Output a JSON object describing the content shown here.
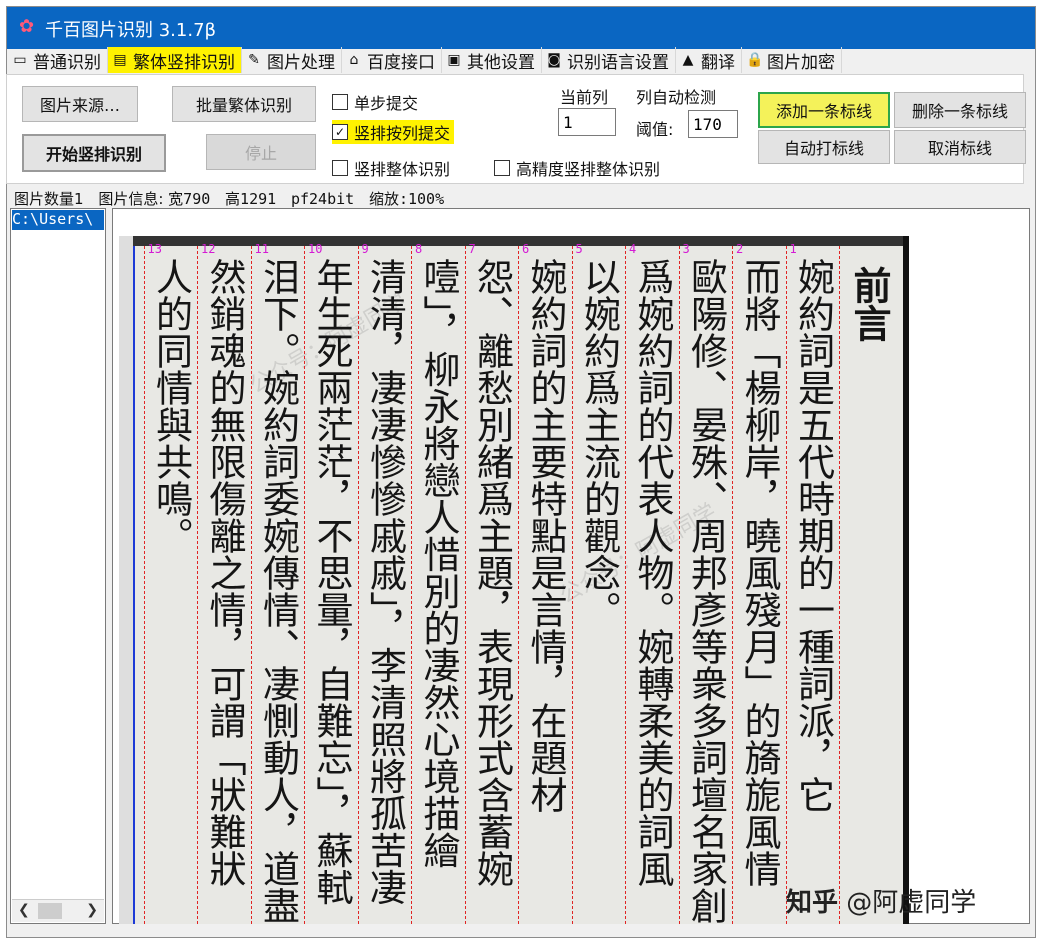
{
  "window": {
    "title": "千百图片识别 3.1.7β",
    "app_icon": "butterfly-icon"
  },
  "tabs": [
    {
      "label": "普通识别",
      "icon": "monitor-icon",
      "icon_char": "▭",
      "active": false
    },
    {
      "label": "繁体竖排识别",
      "icon": "document-icon",
      "icon_char": "▤",
      "active": true
    },
    {
      "label": "图片处理",
      "icon": "edit-image-icon",
      "icon_char": "✎",
      "active": false
    },
    {
      "label": "百度接口",
      "icon": "network-icon",
      "icon_char": "⌂",
      "active": false
    },
    {
      "label": "其他设置",
      "icon": "settings-doc-icon",
      "icon_char": "▣",
      "active": false
    },
    {
      "label": "识别语言设置",
      "icon": "rss-icon",
      "icon_char": "◙",
      "active": false
    },
    {
      "label": "翻译",
      "icon": "translate-icon",
      "icon_char": "▲",
      "active": false
    },
    {
      "label": "图片加密",
      "icon": "lock-icon",
      "icon_char": "🔒",
      "active": false
    }
  ],
  "buttons": {
    "image_source": "图片来源…",
    "batch_traditional": "批量繁体识别",
    "start_vertical": "开始竖排识别",
    "stop": "停止",
    "add_marker": "添加一条标线",
    "delete_marker": "删除一条标线",
    "auto_marker": "自动打标线",
    "cancel_marker": "取消标线"
  },
  "checkboxes": {
    "single_step": {
      "label": "单步提交",
      "checked": false
    },
    "submit_by_column": {
      "label": "竖排按列提交",
      "checked": true
    },
    "whole_vertical": {
      "label": "竖排整体识别",
      "checked": false
    },
    "hp_whole_vertical": {
      "label": "高精度竖排整体识别",
      "checked": false
    }
  },
  "column_settings": {
    "current_column_label": "当前列",
    "current_column_value": "1",
    "auto_detect_label": "列自动检测",
    "threshold_label": "阈值:",
    "threshold_value": "170"
  },
  "status": {
    "count": "图片数量1",
    "info_label": "图片信息:",
    "width": "宽790",
    "height": "高1291",
    "format": "pf24bit",
    "zoom": "缩放:100%"
  },
  "file_list": {
    "selected_path": "C:\\Users\\"
  },
  "document": {
    "heading": "前言",
    "columns": [
      {
        "num": "1",
        "text": "婉約詞是五代時期的一種詞派，它"
      },
      {
        "num": "2",
        "text": "而將「楊柳岸，曉風殘月」的旖旎風情"
      },
      {
        "num": "3",
        "text": "歐陽修、晏殊、周邦彥等衆多詞壇名家創"
      },
      {
        "num": "4",
        "text": "爲婉約詞的代表人物。婉轉柔美的詞風"
      },
      {
        "num": "5",
        "text": "以婉約爲主流的觀念。"
      },
      {
        "num": "6",
        "text": "婉約詞的主要特點是言情，在題材"
      },
      {
        "num": "7",
        "text": "怨、離愁別緒爲主題，表現形式含蓄婉"
      },
      {
        "num": "8",
        "text": "噎」，柳永將戀人惜別的凄然心境描繪"
      },
      {
        "num": "9",
        "text": "清清，凄凄慘慘戚戚」，李清照將孤苦凄"
      },
      {
        "num": "10",
        "text": "年生死兩茫茫，不思量，自難忘」，蘇軾"
      },
      {
        "num": "11",
        "text": "泪下。婉約詞委婉傳情、凄惻動人，道盡"
      },
      {
        "num": "12",
        "text": "然銷魂的無限傷離之情，可謂「狀難狀"
      },
      {
        "num": "13",
        "text": "人的同情與共鳴。"
      }
    ]
  },
  "watermark": {
    "zhihu": "知乎",
    "handle": "@阿虚同学"
  }
}
